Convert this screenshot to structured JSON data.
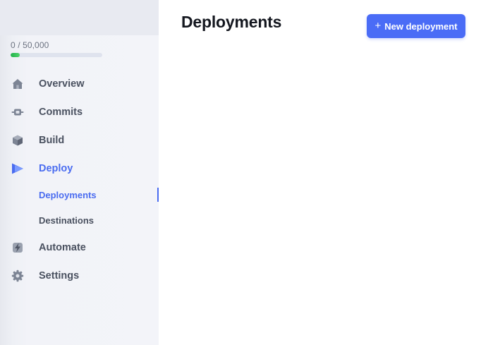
{
  "usage": {
    "text": "0 / 50,000",
    "fraction": 0.1
  },
  "nav": [
    {
      "key": "overview",
      "label": "Overview",
      "icon": "home-icon"
    },
    {
      "key": "commits",
      "label": "Commits",
      "icon": "commit-icon"
    },
    {
      "key": "build",
      "label": "Build",
      "icon": "cube-icon"
    },
    {
      "key": "deploy",
      "label": "Deploy",
      "icon": "play-icon",
      "active": true
    },
    {
      "key": "automate",
      "label": "Automate",
      "icon": "lightning-icon"
    },
    {
      "key": "settings",
      "label": "Settings",
      "icon": "gear-icon"
    }
  ],
  "deploy_sub": [
    {
      "key": "deployments",
      "label": "Deployments",
      "active": true
    },
    {
      "key": "destinations",
      "label": "Destinations"
    }
  ],
  "main": {
    "title": "Deployments",
    "new_button_label": "New deployment",
    "new_button_icon": "plus-icon"
  },
  "colors": {
    "accent": "#4a6cf0",
    "button": "#4a6cf6",
    "usage_fill": "#22b24c",
    "nav_text": "#4a5160"
  }
}
